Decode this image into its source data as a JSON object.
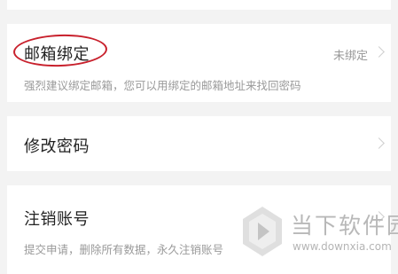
{
  "email_binding": {
    "title": "邮箱绑定",
    "status": "未绑定",
    "description": "强烈建议绑定邮箱，您可以用绑定的邮箱地址来找回密码"
  },
  "change_password": {
    "title": "修改密码"
  },
  "cancel_account": {
    "title": "注销账号",
    "description": "提交申请，删除所有数据，永久注销账号"
  },
  "watermark": {
    "title": "当下软件园",
    "url": "www.downxia.com"
  },
  "colors": {
    "background": "#f3f3f3",
    "card": "#ffffff",
    "annotation": "#c8202c"
  }
}
